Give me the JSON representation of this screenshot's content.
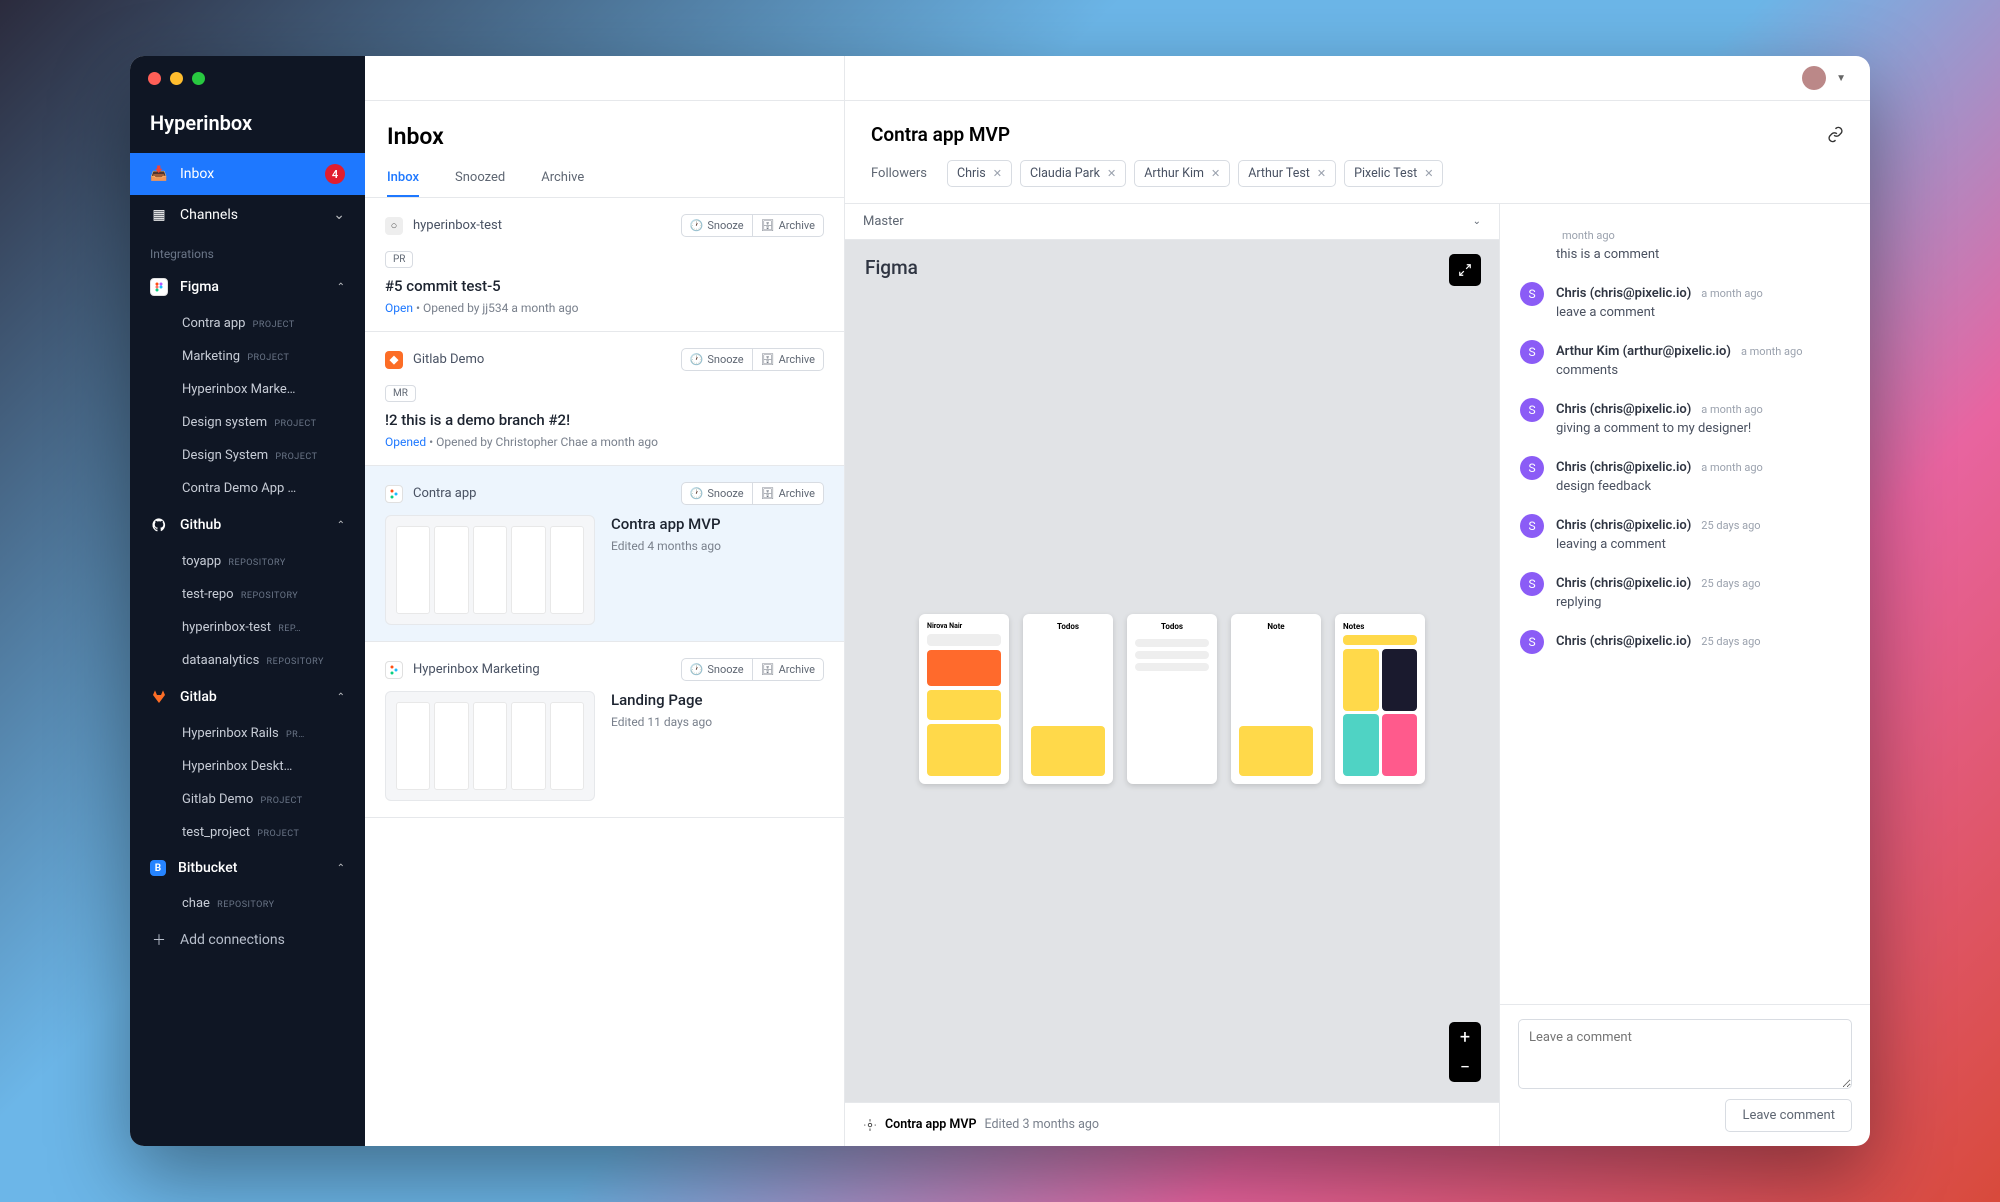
{
  "brand": "Hyperinbox",
  "sidebar": {
    "inbox": {
      "label": "Inbox",
      "badge": "4"
    },
    "channels": "Channels",
    "integrations_label": "Integrations",
    "groups": [
      {
        "name": "Figma",
        "items": [
          {
            "label": "Contra app",
            "tag": "PROJECT"
          },
          {
            "label": "Marketing",
            "tag": "PROJECT"
          },
          {
            "label": "Hyperinbox Marke…",
            "tag": ""
          },
          {
            "label": "Design system",
            "tag": "PROJECT"
          },
          {
            "label": "Design System",
            "tag": "PROJECT"
          },
          {
            "label": "Contra Demo App …",
            "tag": ""
          }
        ]
      },
      {
        "name": "Github",
        "items": [
          {
            "label": "toyapp",
            "tag": "REPOSITORY"
          },
          {
            "label": "test-repo",
            "tag": "REPOSITORY"
          },
          {
            "label": "hyperinbox-test",
            "tag": "REP…"
          },
          {
            "label": "dataanalytics",
            "tag": "REPOSITORY"
          }
        ]
      },
      {
        "name": "Gitlab",
        "items": [
          {
            "label": "Hyperinbox Rails",
            "tag": "PR…"
          },
          {
            "label": "Hyperinbox Deskt…",
            "tag": ""
          },
          {
            "label": "Gitlab Demo",
            "tag": "PROJECT"
          },
          {
            "label": "test_project",
            "tag": "PROJECT"
          }
        ]
      },
      {
        "name": "Bitbucket",
        "items": [
          {
            "label": "chae",
            "tag": "REPOSITORY"
          }
        ]
      }
    ],
    "add": "Add connections"
  },
  "inbox": {
    "title": "Inbox",
    "tabs": [
      "Inbox",
      "Snoozed",
      "Archive"
    ],
    "snooze": "Snooze",
    "archive": "Archive",
    "cards": [
      {
        "src": "hyperinbox-test",
        "pill": "PR",
        "title": "#5 commit test-5",
        "status": "Open",
        "meta": " • Opened by jj534 a month ago"
      },
      {
        "src": "Gitlab Demo",
        "pill": "MR",
        "title": "!2 this is a demo branch #2!",
        "status": "Opened",
        "meta": " • Opened by Christopher Chae a month ago"
      },
      {
        "src": "Contra app",
        "title": "Contra app MVP",
        "sub": "Edited 4 months ago",
        "thumb": true
      },
      {
        "src": "Hyperinbox Marketing",
        "title": "Landing Page",
        "sub": "Edited 11 days ago",
        "thumb": true
      }
    ]
  },
  "detail": {
    "title": "Contra app MVP",
    "followers_lbl": "Followers",
    "followers": [
      "Chris",
      "Claudia Park",
      "Arthur Kim",
      "Arthur Test",
      "Pixelic Test"
    ],
    "master": "Master",
    "figma": "Figma",
    "status_name": "Contra app MVP",
    "status_meta": "Edited 3 months ago",
    "comments": [
      {
        "name": "",
        "time": "month ago",
        "body": "this is a comment",
        "noav": true
      },
      {
        "name": "Chris (chris@pixelic.io)",
        "time": "a month ago",
        "body": "leave a comment"
      },
      {
        "name": "Arthur Kim (arthur@pixelic.io)",
        "time": "a month ago",
        "body": "comments"
      },
      {
        "name": "Chris (chris@pixelic.io)",
        "time": "a month ago",
        "body": "giving a comment to my designer!"
      },
      {
        "name": "Chris (chris@pixelic.io)",
        "time": "a month ago",
        "body": "design feedback"
      },
      {
        "name": "Chris (chris@pixelic.io)",
        "time": "25 days ago",
        "body": "leaving a comment"
      },
      {
        "name": "Chris (chris@pixelic.io)",
        "time": "25 days ago",
        "body": "replying"
      },
      {
        "name": "Chris (chris@pixelic.io)",
        "time": "25 days ago",
        "body": ""
      }
    ],
    "placeholder": "Leave a comment",
    "post": "Leave comment"
  }
}
